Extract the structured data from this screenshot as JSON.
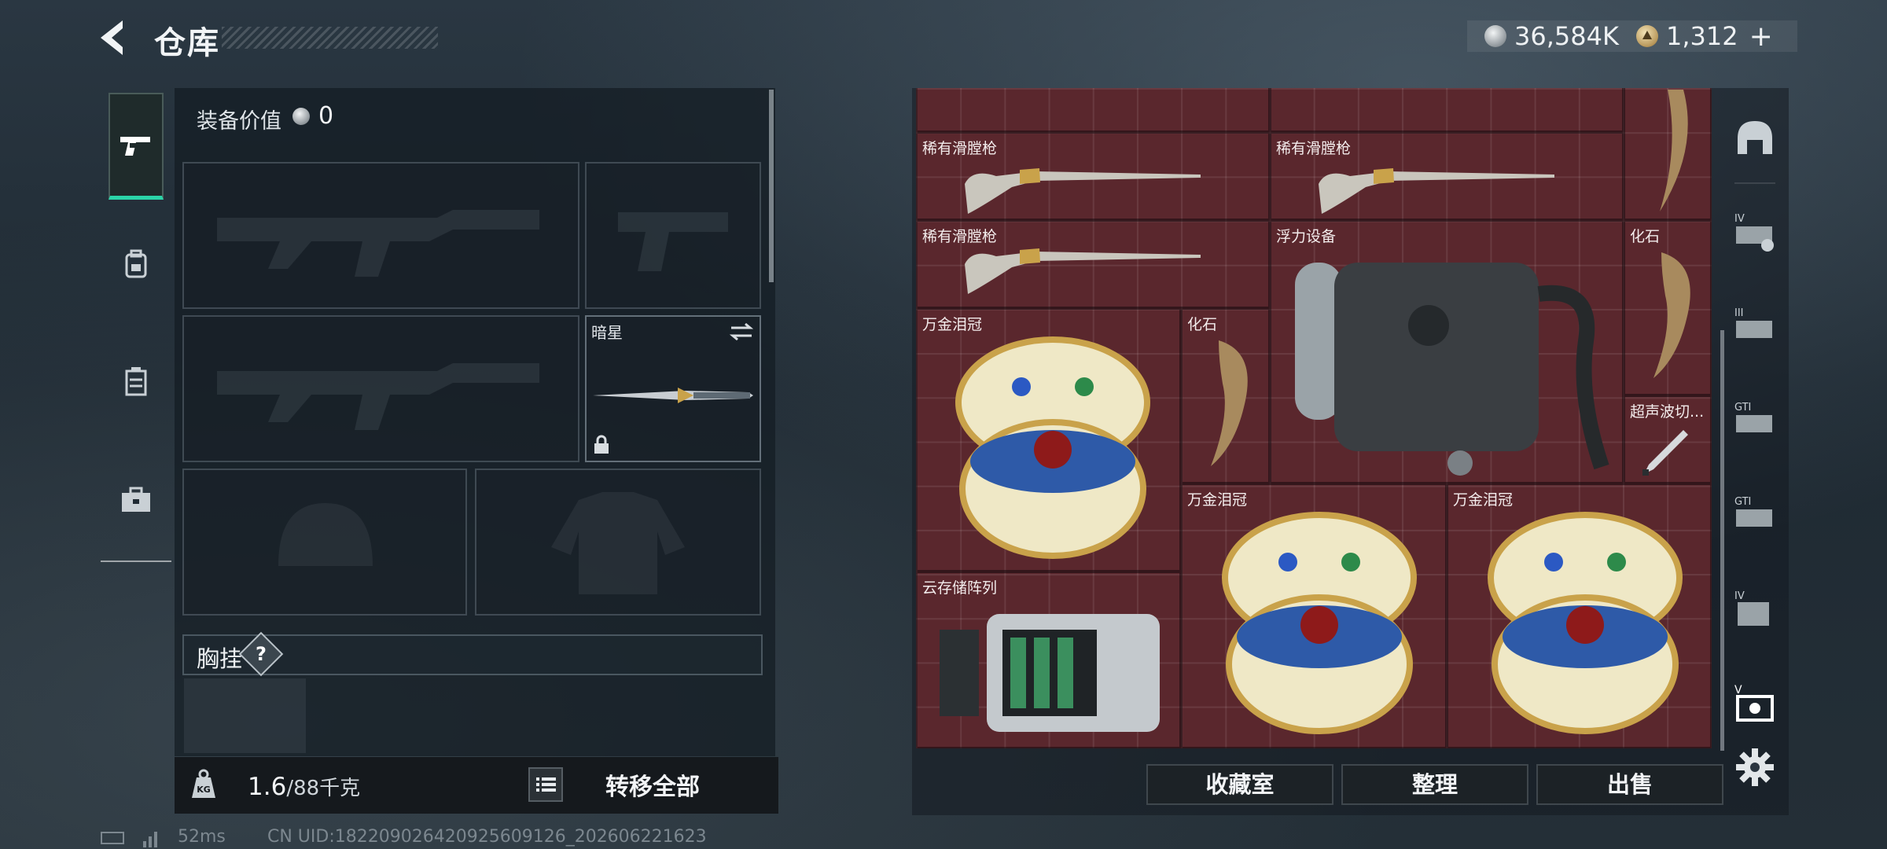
{
  "header": {
    "title": "仓库",
    "currency": [
      {
        "icon": "silver-coin-icon",
        "value": "36,584K"
      },
      {
        "icon": "gold-coin-icon",
        "value": "1,312"
      }
    ],
    "add_symbol": "+"
  },
  "sidebar": {
    "tabs": [
      {
        "icon": "pistol-icon",
        "active": true
      },
      {
        "icon": "backpack-icon",
        "active": false
      },
      {
        "icon": "vest-icon",
        "active": false
      },
      {
        "icon": "briefcase-icon",
        "active": false
      }
    ]
  },
  "equipment": {
    "title": "装备价值",
    "value": "0",
    "slots": {
      "melee_label": "暗星"
    },
    "chest_rig_label": "胸挂",
    "help_symbol": "?",
    "weight_current": "1.6",
    "weight_max": "/88千克",
    "kg_icon_text": "KG",
    "transfer_all": "转移全部"
  },
  "stash": {
    "items": [
      {
        "label": "稀有滑膛枪",
        "icon": "musket-icon"
      },
      {
        "label": "稀有滑膛枪",
        "icon": "musket-icon"
      },
      {
        "label": "稀有滑膛枪",
        "icon": "musket-icon"
      },
      {
        "label": "浮力设备",
        "icon": "buoyancy-device-icon"
      },
      {
        "label": "化石",
        "icon": "fossil-claw-icon"
      },
      {
        "label": "万金泪冠",
        "icon": "jeweled-egg-icon"
      },
      {
        "label": "化石",
        "icon": "fossil-claw-icon"
      },
      {
        "label": "超声波切...",
        "icon": "ultrasonic-cutter-icon"
      },
      {
        "label": "万金泪冠",
        "icon": "jeweled-egg-icon"
      },
      {
        "label": "万金泪冠",
        "icon": "jeweled-egg-icon"
      },
      {
        "label": "云存储阵列",
        "icon": "storage-array-icon"
      }
    ],
    "buttons": {
      "collection": "收藏室",
      "organize": "整理",
      "sell": "出售"
    }
  },
  "rail": {
    "icons": [
      "helmet-icon",
      "tier-iv-rig-icon",
      "tier-iii-rig-icon",
      "tier-gti-rig-icon",
      "tier-gti-rig-icon",
      "tier-iv-case-icon",
      "tier-v-case-icon",
      "settings-gear-icon"
    ]
  },
  "status": {
    "ping": "52ms",
    "uid": "CN UID:182209026420925609126_202606221623"
  }
}
